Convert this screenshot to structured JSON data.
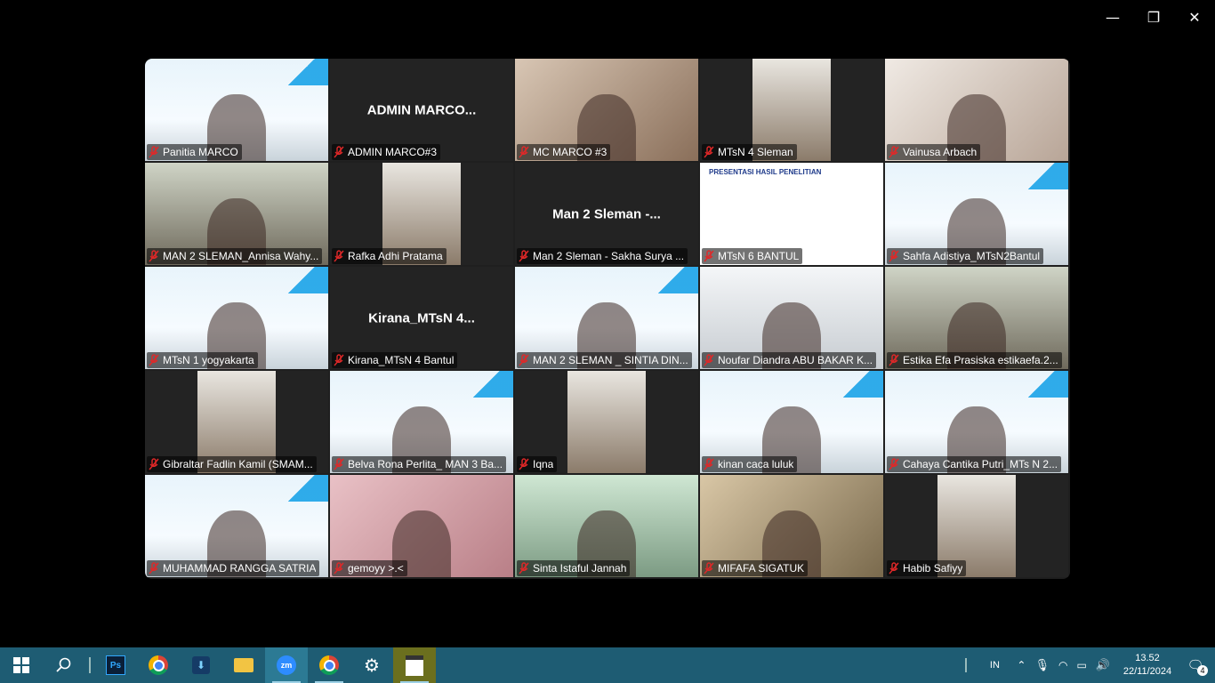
{
  "window": {
    "minimize": "—",
    "restore": "❐",
    "close": "✕"
  },
  "tiles": [
    {
      "name": "Panitia MARCO",
      "video": "frame-light"
    },
    {
      "name": "ADMIN MARCO#3",
      "center": "ADMIN  MARCO..."
    },
    {
      "name": "MC MARCO #3",
      "video": "warm",
      "active": true
    },
    {
      "name": "MTsN 4 Sleman",
      "video": "small-cam"
    },
    {
      "name": "Vainusa Arbach",
      "video": "warm-light"
    },
    {
      "name": "MAN 2 SLEMAN_Annisa Wahy...",
      "video": "room"
    },
    {
      "name": "Rafka Adhi Pratama",
      "video": "small-cam2"
    },
    {
      "name": "Man 2 Sleman - Sakha Surya ...",
      "center": "Man 2 Sleman -..."
    },
    {
      "name": "MTsN 6 BANTUL",
      "video": "poster",
      "poster_title": "PRESENTASI HASIL PENELITIAN"
    },
    {
      "name": "Sahfa Adistiya_MTsN2Bantul",
      "video": "frame-light"
    },
    {
      "name": "MTsN 1 yogyakarta",
      "video": "frame-light"
    },
    {
      "name": "Kirana_MTsN 4 Bantul",
      "center": "Kirana_MTsN  4..."
    },
    {
      "name": "MAN 2 SLEMAN _ SINTIA DIN...",
      "video": "frame-light"
    },
    {
      "name": "Noufar Diandra ABU BAKAR K...",
      "video": "bright"
    },
    {
      "name": "Estika Efa Prasiska estikaefa.2...",
      "video": "room"
    },
    {
      "name": "Gibraltar Fadlin Kamil (SMAM...",
      "video": "small-cam3"
    },
    {
      "name": "Belva Rona Perlita_ MAN 3 Ba...",
      "video": "frame-light"
    },
    {
      "name": "Iqna",
      "video": "small-cam4"
    },
    {
      "name": "kinan caca luluk",
      "video": "frame-light"
    },
    {
      "name": "Cahaya Cantika Putri_MTs N 2...",
      "video": "frame-light"
    },
    {
      "name": "MUHAMMAD RANGGA SATRIA",
      "video": "frame-light"
    },
    {
      "name": "gemoyy >.<",
      "video": "pink"
    },
    {
      "name": "Sinta Istaful Jannah",
      "video": "green-room"
    },
    {
      "name": "MIFAFA SIGATUK",
      "video": "warm2"
    },
    {
      "name": "Habib Safiyy",
      "video": "small-cam5"
    }
  ],
  "taskbar": {
    "apps": [
      "start",
      "search",
      "divider",
      "photoshop",
      "chrome",
      "app-blue",
      "file-explorer",
      "zoom",
      "chrome-profile",
      "settings",
      "media"
    ],
    "lang": "IN",
    "time": "13.52",
    "date": "22/11/2024",
    "notif_count": "4"
  },
  "colors": {
    "active": "#2ed18a",
    "taskbar": "#1e5c73",
    "mic_off": "#e02828"
  }
}
